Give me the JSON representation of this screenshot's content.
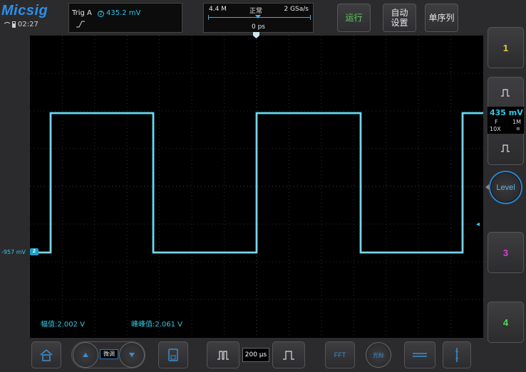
{
  "brand": {
    "logo": "Micsig"
  },
  "status": {
    "time": "02:27"
  },
  "trigger": {
    "label": "Trig  A",
    "source": "2",
    "level": "435.2  mV"
  },
  "acquisition": {
    "depth": "4.4 M",
    "mode": "正常",
    "rate": "2 GSa/s",
    "delay": "0 ps"
  },
  "top_buttons": {
    "run": "运行",
    "auto": "自动\n设置",
    "single": "单序列"
  },
  "measurements": {
    "amplitude": "幅值:2.002 V",
    "peak_to_peak": "峰峰值:2.061 V"
  },
  "channel_marker": {
    "offset": "-957 mV",
    "id": "2"
  },
  "channels": {
    "ch1": "1",
    "ch2": {
      "volts_div": "435 mV",
      "coupling": "F",
      "impedance": "1M",
      "probe": "10X",
      "bw": "≡"
    },
    "ch3": "3",
    "ch4": "4"
  },
  "level_knob": "Level",
  "bottom": {
    "timebase": "200 μs",
    "fine": "微调",
    "fft": "FFT",
    "cursor": "光标"
  },
  "colors": {
    "ch1": "#e8d23a",
    "ch2": "#35c8e8",
    "ch3": "#e03ad8",
    "ch4": "#4fdc4f",
    "accent": "#2a84c8",
    "run": "#5fd05f"
  }
}
